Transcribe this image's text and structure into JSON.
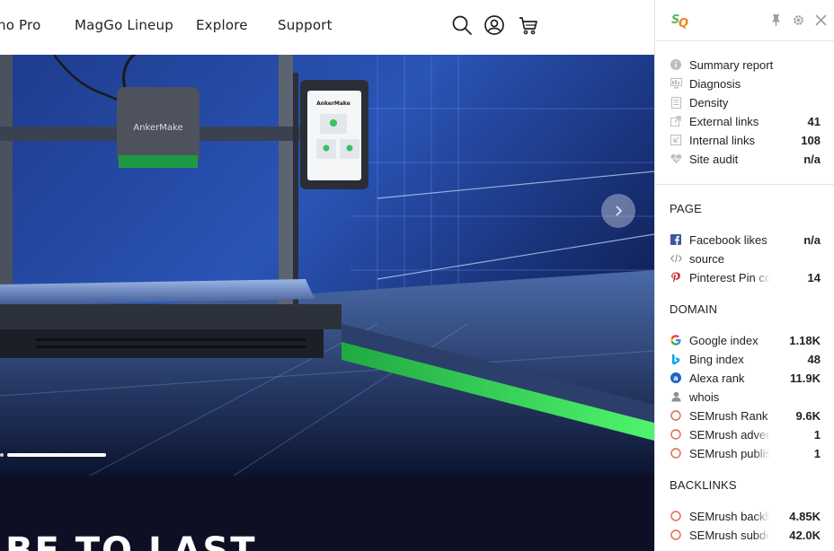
{
  "nav": {
    "links": [
      "no Pro",
      "MagGo Lineup",
      "Explore",
      "Support"
    ]
  },
  "hero": {
    "printer_brand": "AnkerMake",
    "screen_brand": "AnkerMake",
    "carousel_next_icon": "chevron-right-icon"
  },
  "band": {
    "headline": "BE TO LAST"
  },
  "seoquake": {
    "logo_text": "SQ",
    "header_icons": [
      "pin-icon",
      "gear-icon",
      "close-icon"
    ],
    "top_items": [
      {
        "label": "Summary report",
        "value": "",
        "icon": "info-icon"
      },
      {
        "label": "Diagnosis",
        "value": "",
        "icon": "monitor-icon"
      },
      {
        "label": "Density",
        "value": "",
        "icon": "document-icon"
      },
      {
        "label": "External links",
        "value": "41",
        "icon": "external-link-icon"
      },
      {
        "label": "Internal links",
        "value": "108",
        "icon": "internal-link-icon"
      },
      {
        "label": "Site audit",
        "value": "n/a",
        "icon": "heartbeat-icon"
      }
    ],
    "page": {
      "title": "PAGE",
      "items": [
        {
          "label": "Facebook likes",
          "value": "n/a",
          "icon": "facebook-icon"
        },
        {
          "label": "source",
          "value": "",
          "icon": "code-icon"
        },
        {
          "label": "Pinterest Pin co",
          "value": "14",
          "icon": "pinterest-icon"
        }
      ]
    },
    "domain": {
      "title": "DOMAIN",
      "items": [
        {
          "label": "Google index",
          "value": "1.18K",
          "icon": "google-icon"
        },
        {
          "label": "Bing index",
          "value": "48",
          "icon": "bing-icon"
        },
        {
          "label": "Alexa rank",
          "value": "11.9K",
          "icon": "alexa-icon"
        },
        {
          "label": "whois",
          "value": "",
          "icon": "user-icon"
        },
        {
          "label": "SEMrush Rank",
          "value": "9.6K",
          "icon": "semrush-icon"
        },
        {
          "label": "SEMrush advert",
          "value": "1",
          "icon": "semrush-icon"
        },
        {
          "label": "SEMrush publis",
          "value": "1",
          "icon": "semrush-icon"
        }
      ]
    },
    "backlinks": {
      "title": "BACKLINKS",
      "items": [
        {
          "label": "SEMrush backli",
          "value": "4.85K",
          "icon": "semrush-icon"
        },
        {
          "label": "SEMrush subdo",
          "value": "42.0K",
          "icon": "semrush-icon"
        }
      ]
    }
  },
  "colors": {
    "semrush": "#e06a47",
    "facebook": "#3b5998",
    "pinterest": "#cb2027",
    "bing": "#00a4ef",
    "alexa": "#1d64c8",
    "sq_green": "#5cb85c",
    "sq_orange": "#f58220",
    "hero_green": "#36e65a",
    "band_bg": "#0d0f24"
  }
}
